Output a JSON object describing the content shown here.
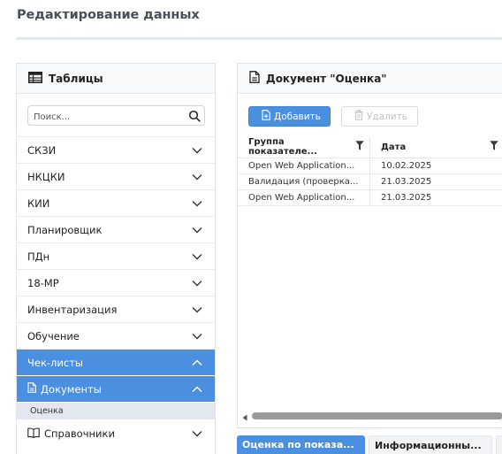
{
  "page": {
    "title": "Редактирование данных"
  },
  "sidebar": {
    "title": "Таблицы",
    "search_placeholder": "Поиск...",
    "items": [
      {
        "label": "СКЗИ",
        "state": "collapsed"
      },
      {
        "label": "НКЦКИ",
        "state": "collapsed"
      },
      {
        "label": "КИИ",
        "state": "collapsed"
      },
      {
        "label": "Планировщик",
        "state": "collapsed"
      },
      {
        "label": "ПДн",
        "state": "collapsed"
      },
      {
        "label": "18-МР",
        "state": "collapsed"
      },
      {
        "label": "Инвентаризация",
        "state": "collapsed"
      },
      {
        "label": "Обучение",
        "state": "collapsed"
      },
      {
        "label": "Чек-листы",
        "state": "expanded"
      },
      {
        "label": "Документы",
        "state": "expanded"
      },
      {
        "label": "Справочники",
        "state": "collapsed"
      }
    ],
    "sub_item": "Оценка"
  },
  "document": {
    "title": "Документ \"Оценка\"",
    "add_label": "Добавить",
    "delete_label": "Удалить",
    "columns": [
      "Группа показателе...",
      "Дата"
    ],
    "rows": [
      [
        "Open Web Application...",
        "10.02.2025"
      ],
      [
        "Валидация (проверка...",
        "21.03.2025"
      ],
      [
        "Open Web Application...",
        "21.03.2025"
      ]
    ]
  },
  "tabs": [
    "Оценка по показа...",
    "Информационны...",
    "С"
  ],
  "colors": {
    "accent": "#4a8fe0",
    "sub_item_bg": "#e3e8f0"
  }
}
